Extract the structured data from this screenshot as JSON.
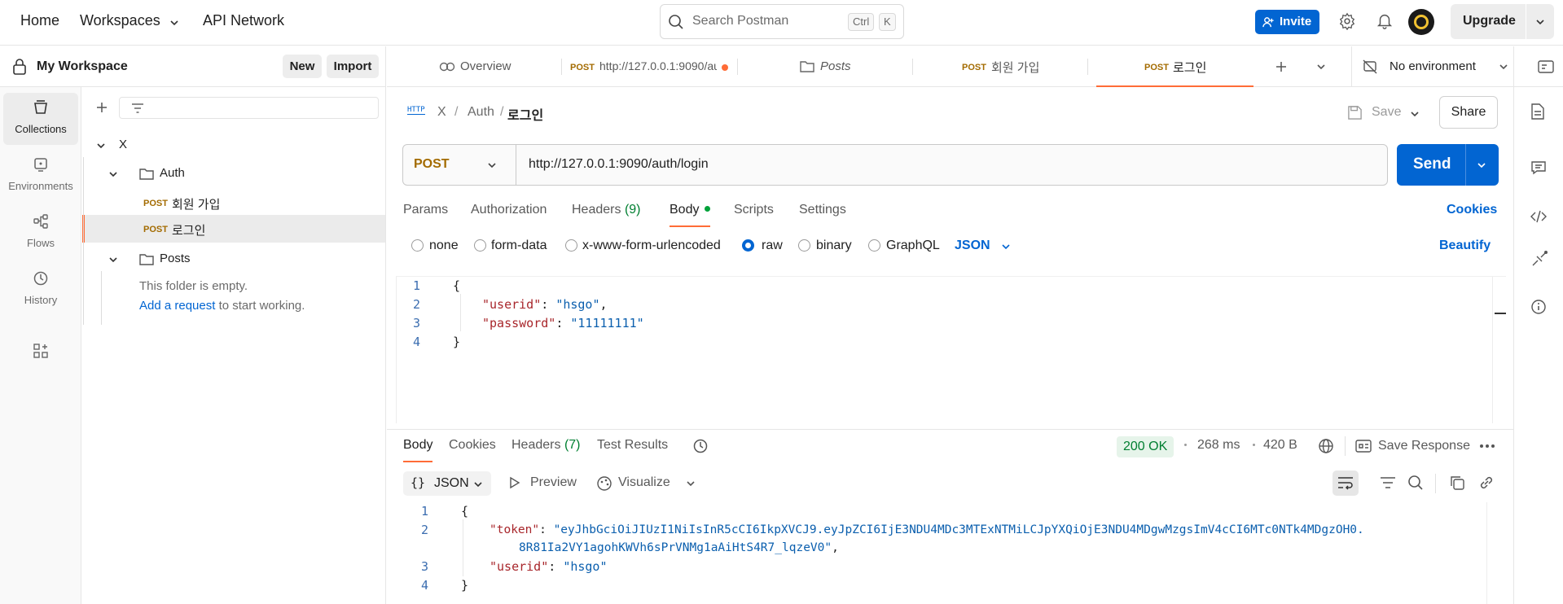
{
  "topbar": {
    "home": "Home",
    "workspaces": "Workspaces",
    "api_network": "API Network",
    "search_placeholder": "Search Postman",
    "kbd_ctrl": "Ctrl",
    "kbd_k": "K",
    "invite": "Invite",
    "upgrade": "Upgrade"
  },
  "workspace": {
    "name": "My Workspace",
    "new_label": "New",
    "import_label": "Import"
  },
  "rail": [
    {
      "label": "Collections",
      "icon": "collections-icon",
      "active": true
    },
    {
      "label": "Environments",
      "icon": "environments-icon",
      "active": false
    },
    {
      "label": "Flows",
      "icon": "flows-icon",
      "active": false
    },
    {
      "label": "History",
      "icon": "history-icon",
      "active": false
    }
  ],
  "tree": {
    "collection": "X",
    "auth_folder": "Auth",
    "req1_method": "POST",
    "req1_name": "회원 가입",
    "req2_method": "POST",
    "req2_name": "로그인",
    "posts_folder": "Posts",
    "empty_text": "This folder is empty.",
    "add_request": "Add a request",
    "add_request_suffix": " to start working."
  },
  "tabs": {
    "overview": "Overview",
    "tab2_method": "POST",
    "tab2_label": "http://127.0.0.1:9090/au",
    "tab3_label": "Posts",
    "tab4_method": "POST",
    "tab4_label": "회원 가입",
    "tab5_method": "POST",
    "tab5_label": "로그인",
    "environment": "No environment"
  },
  "request": {
    "http_badge": "HTTP",
    "crumb_1": "X",
    "crumb_2": "Auth",
    "crumb_3": "로그인",
    "save_label": "Save",
    "share_label": "Share",
    "method": "POST",
    "url": "http://127.0.0.1:9090/auth/login",
    "send_label": "Send",
    "subtabs": {
      "params": "Params",
      "authorization": "Authorization",
      "headers": "Headers",
      "headers_count": "(9)",
      "body": "Body",
      "scripts": "Scripts",
      "settings": "Settings",
      "cookies": "Cookies"
    },
    "body_types": {
      "none": "none",
      "form_data": "form-data",
      "urlencoded": "x-www-form-urlencoded",
      "raw": "raw",
      "binary": "binary",
      "graphql": "GraphQL",
      "json": "JSON",
      "beautify": "Beautify"
    },
    "body_lines": {
      "n1": "1",
      "n2": "2",
      "n3": "3",
      "n4": "4",
      "open": "{",
      "key1": "\"userid\"",
      "val1": "\"hsgo\"",
      "key2": "\"password\"",
      "val2": "\"11111111\"",
      "close": "}"
    }
  },
  "response": {
    "tabs": {
      "body": "Body",
      "cookies": "Cookies",
      "headers": "Headers",
      "headers_count": "(7)",
      "test_results": "Test Results"
    },
    "status": "200 OK",
    "time": "268 ms",
    "size": "420 B",
    "save_response": "Save Response",
    "format": "JSON",
    "preview": "Preview",
    "visualize": "Visualize",
    "lines": {
      "n1": "1",
      "n2": "2",
      "n3": "3",
      "n4": "4",
      "open": "{",
      "key1": "\"token\"",
      "val1a": "\"eyJhbGciOiJIUzI1NiIsInR5cCI6IkpXVCJ9.eyJpZCI6IjE3NDU4MDc3MTExNTMiLCJpYXQiOjE3NDU4MDgwMzgsImV4cCI6MTc0NTk4MDgzOH0.",
      "val1b": "8R81Ia2VY1agohKWVh6sPrVNMg1aAiHtS4R7_lqzeV0\"",
      "key2": "\"userid\"",
      "val2": "\"hsgo\"",
      "close": "}"
    }
  },
  "colors": {
    "accent_orange": "#ff6c37",
    "primary_blue": "#0265d2",
    "post_method": "#a36b00",
    "status_green": "#007f31"
  }
}
